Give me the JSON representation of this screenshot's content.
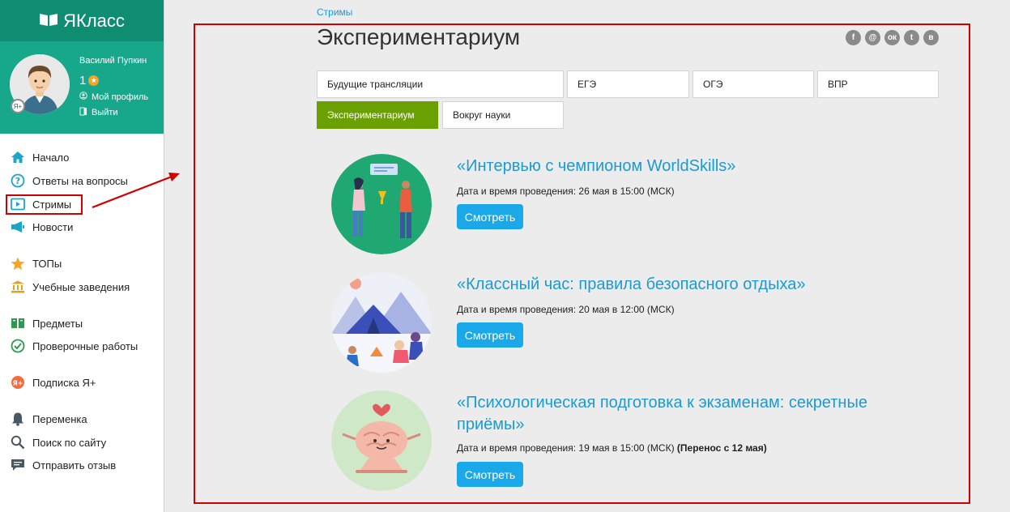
{
  "brand": {
    "name": "ЯКласс"
  },
  "profile": {
    "name": "Василий Пупкин",
    "score": "1",
    "badge": "Я+",
    "links": [
      {
        "label": "Мой профиль",
        "icon": "user-circle-icon"
      },
      {
        "label": "Выйти",
        "icon": "exit-door-icon"
      }
    ]
  },
  "nav": [
    {
      "label": "Начало",
      "icon": "home-icon"
    },
    {
      "label": "Ответы на вопросы",
      "icon": "question-circle-icon"
    },
    {
      "label": "Стримы",
      "icon": "play-icon"
    },
    {
      "label": "Новости",
      "icon": "megaphone-icon"
    },
    {
      "label": "ТОПы",
      "icon": "star-icon"
    },
    {
      "label": "Учебные заведения",
      "icon": "institution-icon"
    },
    {
      "label": "Предметы",
      "icon": "books-icon"
    },
    {
      "label": "Проверочные работы",
      "icon": "check-circle-icon"
    },
    {
      "label": "Подписка Я+",
      "icon": "ya-plus-icon"
    },
    {
      "label": "Переменка",
      "icon": "bell-icon"
    },
    {
      "label": "Поиск по сайту",
      "icon": "search-icon"
    },
    {
      "label": "Отправить отзыв",
      "icon": "comment-icon"
    }
  ],
  "breadcrumb": "Стримы",
  "title": "Экспериментариум",
  "social": [
    "f",
    "@",
    "ок",
    "t",
    "в"
  ],
  "tabs": [
    {
      "label": "Будущие трансляции"
    },
    {
      "label": "ЕГЭ"
    },
    {
      "label": "ОГЭ"
    },
    {
      "label": "ВПР"
    },
    {
      "label": "Экспериментариум"
    },
    {
      "label": "Вокруг науки"
    }
  ],
  "streams": [
    {
      "title": "«Интервью с чемпионом WorldSkills»",
      "date": "Дата и время проведения: 26 мая в 15:00 (МСК)",
      "date_extra": "",
      "button": "Смотреть"
    },
    {
      "title": "«Классный час: правила безопасного отдыха»",
      "date": "Дата и время проведения: 20 мая в 12:00 (МСК)",
      "date_extra": "",
      "button": "Смотреть"
    },
    {
      "title_line1": "«Психологическая подготовка к экзаменам: секретные",
      "title_line2": "приёмы»",
      "date": "Дата и время проведения: 19 мая в 15:00 (МСК) ",
      "date_extra": "(Перенос с 12 мая)",
      "button": "Смотреть"
    }
  ],
  "colors": {
    "brand_dark": "#0f8d72",
    "brand": "#17a88b",
    "link": "#1a9ad6",
    "button": "#1aa8e8",
    "active_tab": "#6aa000",
    "highlight": "#d00000"
  }
}
